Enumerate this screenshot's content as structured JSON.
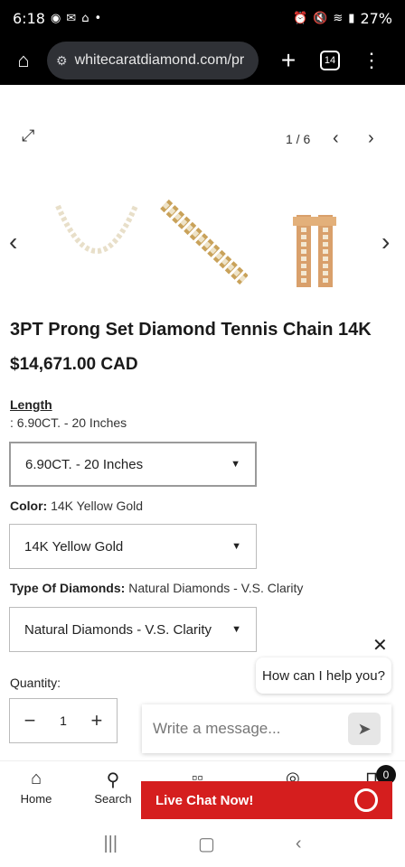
{
  "status_bar": {
    "time": "6:18",
    "battery": "27%"
  },
  "browser": {
    "url": "whitecaratdiamond.com/pr",
    "tab_count": "14"
  },
  "gallery": {
    "counter": "1 / 6"
  },
  "product": {
    "title": "3PT Prong Set Diamond Tennis Chain 14K",
    "price": "$14,671.00 CAD"
  },
  "options": {
    "length": {
      "label": "Length",
      "value_text": ": 6.90CT. - 20 Inches",
      "selected": "6.90CT. - 20 Inches"
    },
    "color": {
      "label": "Color:",
      "value_text": "14K Yellow Gold",
      "selected": "14K Yellow Gold"
    },
    "diamonds": {
      "label": "Type Of Diamonds:",
      "value_text": "Natural Diamonds - V.S. Clarity",
      "selected": "Natural Diamonds - V.S. Clarity"
    }
  },
  "quantity": {
    "label": "Quantity:",
    "value": "1"
  },
  "chat": {
    "greeting": "How can I help you?",
    "input_placeholder": "Write a message...",
    "live_chat_label": "Live Chat Now!"
  },
  "bottom_nav": {
    "home_label": "Home",
    "search_label": "Search",
    "cart_count": "0"
  },
  "colors": {
    "live_chat_bg": "#d51e1e",
    "status_bg": "#000000"
  }
}
